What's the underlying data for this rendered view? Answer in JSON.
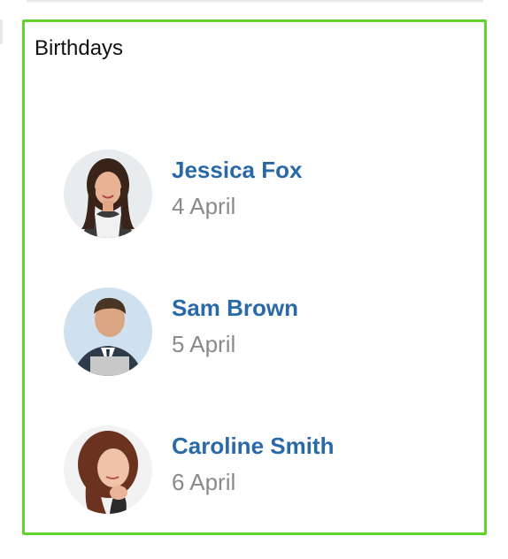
{
  "widget": {
    "title": "Birthdays"
  },
  "people": [
    {
      "name": "Jessica Fox",
      "date": "4 April",
      "avatar_icon": "woman-dark-hair-avatar"
    },
    {
      "name": "Sam Brown",
      "date": "5 April",
      "avatar_icon": "man-with-tablet-avatar"
    },
    {
      "name": "Caroline Smith",
      "date": "6 April",
      "avatar_icon": "woman-red-hair-avatar"
    }
  ],
  "colors": {
    "border": "#5fd42c",
    "name": "#2a69a8",
    "date": "#8a8a8a"
  }
}
